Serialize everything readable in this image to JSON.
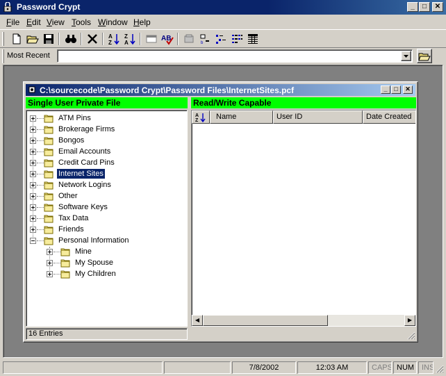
{
  "window": {
    "title": "Password Crypt"
  },
  "menu": [
    {
      "label": "File",
      "u": "F",
      "rest": "ile"
    },
    {
      "label": "Edit",
      "u": "E",
      "rest": "dit"
    },
    {
      "label": "View",
      "u": "V",
      "rest": "iew"
    },
    {
      "label": "Tools",
      "u": "T",
      "rest": "ools"
    },
    {
      "label": "Window",
      "u": "W",
      "rest": "indow"
    },
    {
      "label": "Help",
      "u": "H",
      "rest": "elp"
    }
  ],
  "toolbar": {
    "icons": [
      "new-document-icon",
      "open-folder-icon",
      "save-icon",
      "find-binoculars-icon",
      "delete-x-icon",
      "sort-ascending-icon",
      "sort-descending-icon",
      "window-icon",
      "spell-check-icon",
      "properties-icon",
      "large-icons-icon",
      "small-icons-icon",
      "list-view-icon",
      "details-view-icon"
    ]
  },
  "address": {
    "label": "Most Recent",
    "value": ""
  },
  "doc": {
    "title": "C:\\sourcecode\\Password Crypt\\Password Files\\InternetSites.pcf",
    "left_header": "Single User Private File",
    "right_header": "Read/Write Capable",
    "entries": "16 Entries"
  },
  "tree": [
    {
      "label": "ATM Pins",
      "level": 0,
      "exp": "plus"
    },
    {
      "label": "Brokerage Firms",
      "level": 0,
      "exp": "plus"
    },
    {
      "label": "Bongos",
      "level": 0,
      "exp": "plus"
    },
    {
      "label": "Email Accounts",
      "level": 0,
      "exp": "plus"
    },
    {
      "label": "Credit Card Pins",
      "level": 0,
      "exp": "plus"
    },
    {
      "label": "Internet Sites",
      "level": 0,
      "exp": "plus",
      "selected": true
    },
    {
      "label": "Network Logins",
      "level": 0,
      "exp": "plus"
    },
    {
      "label": "Other",
      "level": 0,
      "exp": "plus"
    },
    {
      "label": "Software Keys",
      "level": 0,
      "exp": "plus"
    },
    {
      "label": "Tax Data",
      "level": 0,
      "exp": "plus"
    },
    {
      "label": "Friends",
      "level": 0,
      "exp": "plus"
    },
    {
      "label": "Personal Information",
      "level": 0,
      "exp": "minus"
    },
    {
      "label": "Mine",
      "level": 1,
      "exp": "plus"
    },
    {
      "label": "My Spouse",
      "level": 1,
      "exp": "plus"
    },
    {
      "label": "My Children",
      "level": 1,
      "exp": "plus"
    }
  ],
  "list": {
    "columns": [
      "Name",
      "User ID",
      "Date Created"
    ]
  },
  "status": {
    "date": "7/8/2002",
    "time": "12:03 AM",
    "caps": "CAPS",
    "num": "NUM",
    "ins": "INS"
  }
}
